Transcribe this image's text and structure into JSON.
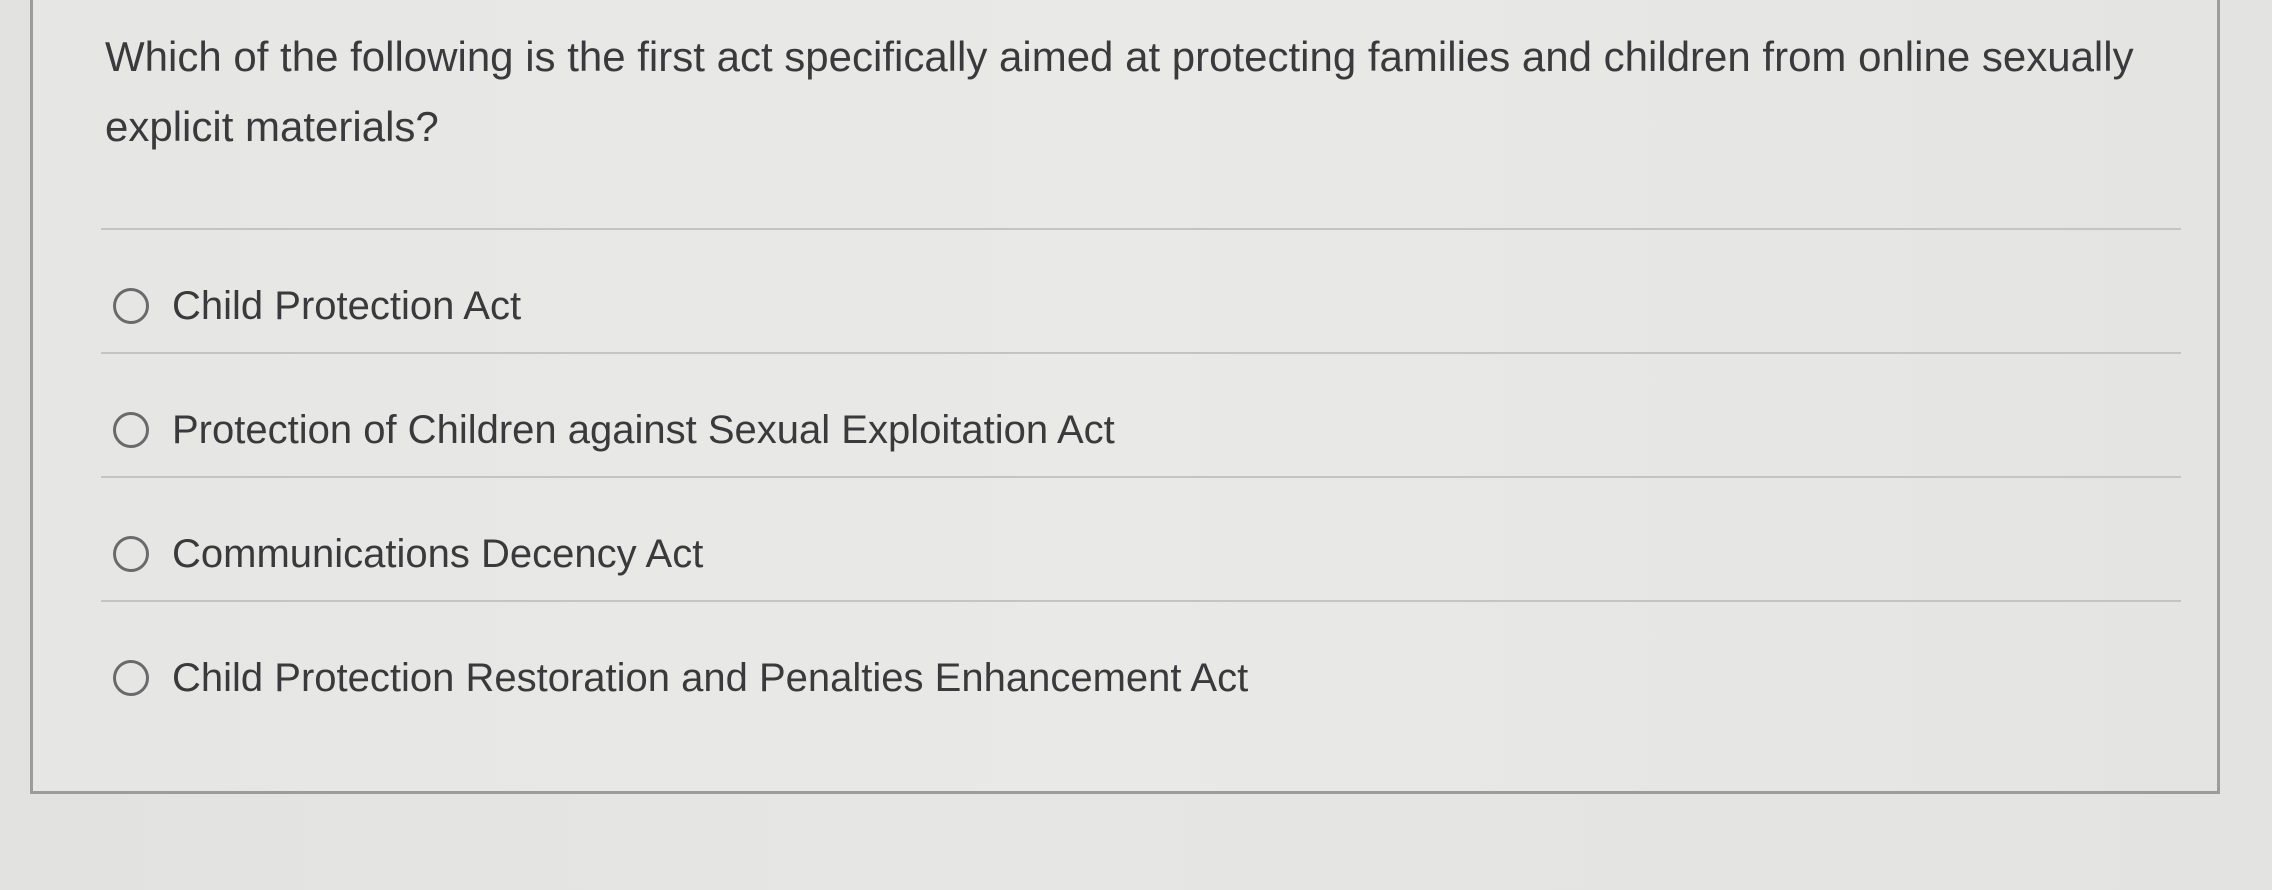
{
  "question": {
    "text": "Which of the following is the first act specifically aimed at protecting families and children from online sexually explicit materials?"
  },
  "options": [
    {
      "label": "Child Protection Act",
      "selected": false
    },
    {
      "label": "Protection of Children against Sexual Exploitation Act",
      "selected": false
    },
    {
      "label": "Communications Decency Act",
      "selected": false
    },
    {
      "label": "Child Protection Restoration and Penalties Enhancement Act",
      "selected": false
    }
  ]
}
